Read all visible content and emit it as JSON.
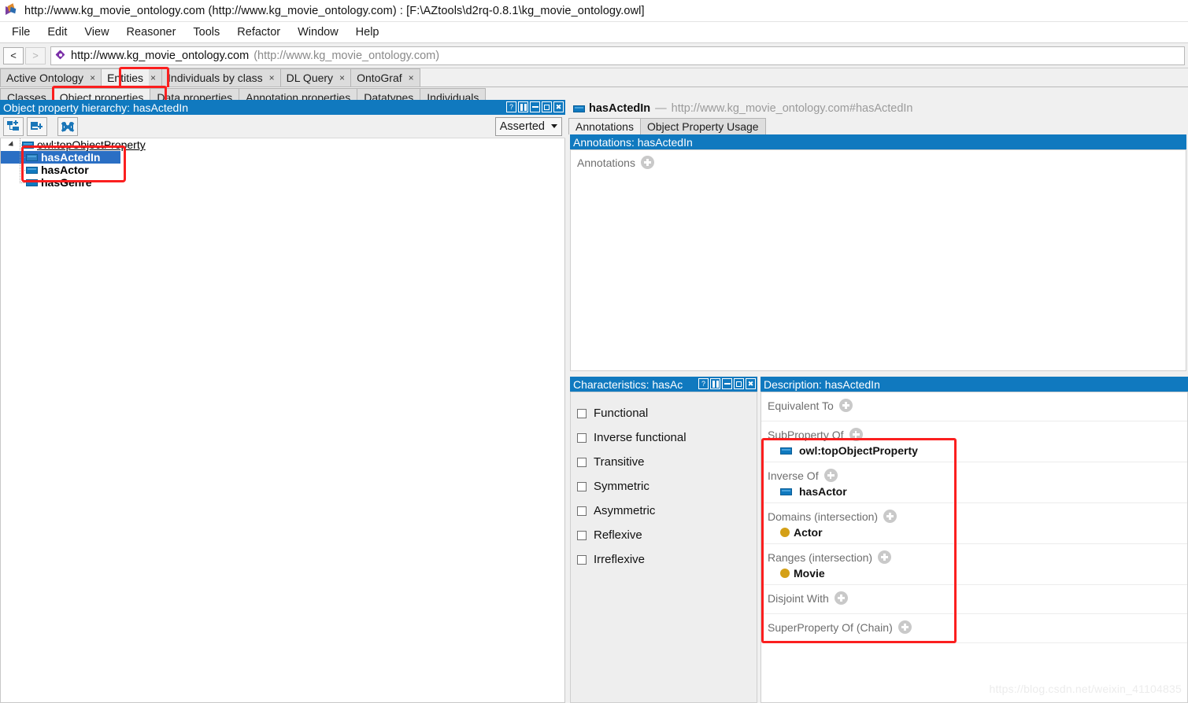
{
  "window": {
    "title": "http://www.kg_movie_ontology.com (http://www.kg_movie_ontology.com)  : [F:\\AZtools\\d2rq-0.8.1\\kg_movie_ontology.owl]",
    "app_icon": "protege-logo-icon"
  },
  "menubar": {
    "items": [
      {
        "label": "File"
      },
      {
        "label": "Edit"
      },
      {
        "label": "View"
      },
      {
        "label": "Reasoner"
      },
      {
        "label": "Tools"
      },
      {
        "label": "Refactor"
      },
      {
        "label": "Window"
      },
      {
        "label": "Help"
      }
    ]
  },
  "navbar": {
    "back_label": "<",
    "forward_label": ">",
    "iri_icon": "ontology-iri-icon",
    "ontology_iri": "http://www.kg_movie_ontology.com",
    "ontology_iri_alt": "(http://www.kg_movie_ontology.com)"
  },
  "tabs": {
    "items": [
      {
        "label": "Active Ontology",
        "close": "×",
        "active": false
      },
      {
        "label": "Entities",
        "close": "×",
        "active": true
      },
      {
        "label": "Individuals by class",
        "close": "×",
        "active": false
      },
      {
        "label": "DL Query",
        "close": "×",
        "active": false
      },
      {
        "label": "OntoGraf",
        "close": "×",
        "active": false
      }
    ]
  },
  "subtabs": {
    "items": [
      {
        "label": "Classes",
        "active": false
      },
      {
        "label": "Object properties",
        "active": true
      },
      {
        "label": "Data properties",
        "active": false
      },
      {
        "label": "Annotation properties",
        "active": false
      },
      {
        "label": "Datatypes",
        "active": false
      },
      {
        "label": "Individuals",
        "active": false
      }
    ]
  },
  "hierarchy_panel": {
    "title": "Object property hierarchy: hasActedIn",
    "controls": [
      "help-icon",
      "split-icon",
      "minimize-icon",
      "maximize-icon",
      "close-icon"
    ],
    "toolbar": {
      "add_sub_property": "add-sub-property-button",
      "add_sibling_property": "add-sibling-property-button",
      "delete_property": "delete-property-button"
    },
    "view_selector": {
      "value": "Asserted"
    },
    "tree": [
      {
        "label": "owl:topObjectProperty",
        "level": 0,
        "selected": false,
        "expanded": true
      },
      {
        "label": "hasActedIn",
        "level": 1,
        "selected": true
      },
      {
        "label": "hasActor",
        "level": 1,
        "selected": false
      },
      {
        "label": "hasGenre",
        "level": 1,
        "selected": false
      }
    ]
  },
  "entity": {
    "icon": "object-property-icon",
    "name": "hasActedIn",
    "dash": "—",
    "iri": "http://www.kg_movie_ontology.com#hasActedIn",
    "tabs": [
      {
        "label": "Annotations",
        "active": true
      },
      {
        "label": "Object Property Usage",
        "active": false
      }
    ]
  },
  "annotations_panel": {
    "title": "Annotations: hasActedIn",
    "add_label": "Annotations",
    "add_icon": "add-annotation-button"
  },
  "characteristics_panel": {
    "title": "Characteristics: hasAc",
    "controls": [
      "help-icon",
      "split-icon",
      "minimize-icon",
      "maximize-icon",
      "close-icon"
    ],
    "items": [
      {
        "label": "Functional",
        "checked": false
      },
      {
        "label": "Inverse functional",
        "checked": false
      },
      {
        "label": "Transitive",
        "checked": false
      },
      {
        "label": "Symmetric",
        "checked": false
      },
      {
        "label": "Asymmetric",
        "checked": false
      },
      {
        "label": "Reflexive",
        "checked": false
      },
      {
        "label": "Irreflexive",
        "checked": false
      }
    ]
  },
  "description_panel": {
    "title": "Description: hasActedIn",
    "sections": [
      {
        "label": "Equivalent To",
        "add_icon": "add-equivalent-to-button",
        "items": []
      },
      {
        "label": "SubProperty Of",
        "add_icon": "add-subproperty-of-button",
        "items": [
          {
            "text": "owl:topObjectProperty",
            "icon": "object-property-icon"
          }
        ]
      },
      {
        "label": "Inverse Of",
        "add_icon": "add-inverse-of-button",
        "items": [
          {
            "text": "hasActor",
            "icon": "object-property-icon"
          }
        ]
      },
      {
        "label": "Domains (intersection)",
        "add_icon": "add-domain-button",
        "items": [
          {
            "text": "Actor",
            "icon": "class-icon"
          }
        ]
      },
      {
        "label": "Ranges (intersection)",
        "add_icon": "add-range-button",
        "items": [
          {
            "text": "Movie",
            "icon": "class-icon"
          }
        ]
      },
      {
        "label": "Disjoint With",
        "add_icon": "add-disjoint-with-button",
        "items": []
      },
      {
        "label": "SuperProperty Of (Chain)",
        "add_icon": "add-superproperty-chain-button",
        "items": []
      }
    ]
  },
  "watermark": {
    "text": "https://blog.csdn.net/weixin_41104835"
  },
  "colors": {
    "accent_blue": "#1079bf",
    "selection_blue": "#2a6fc4",
    "highlight_red": "#fb1f1f",
    "class_yellow": "#d4a017",
    "property_blue": "#1079bf"
  }
}
